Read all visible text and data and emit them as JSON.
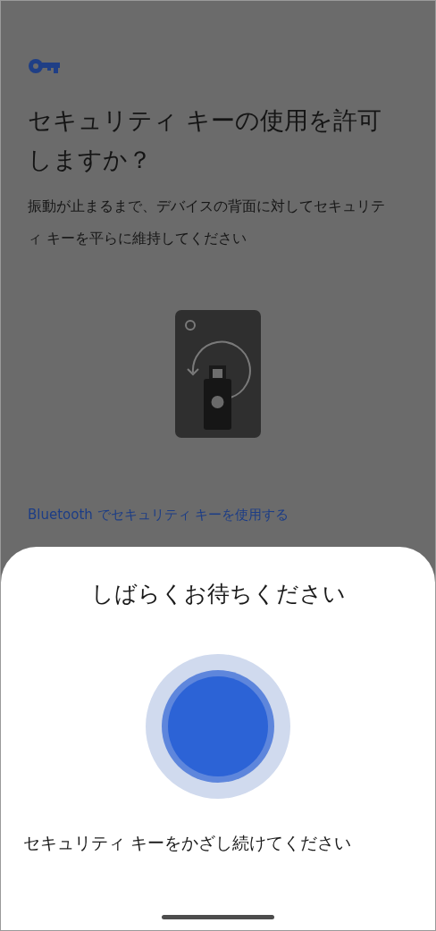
{
  "page": {
    "title": "セキュリティ キーの使用を許可しますか？",
    "description": "振動が止まるまで、デバイスの背面に対してセキュリティ キーを平らに維持してください"
  },
  "links": [
    {
      "label": "Bluetooth でセキュリティ キーを使用する"
    }
  ],
  "sheet": {
    "title": "しばらくお待ちください",
    "message": "セキュリティ キーをかざし続けてください"
  }
}
